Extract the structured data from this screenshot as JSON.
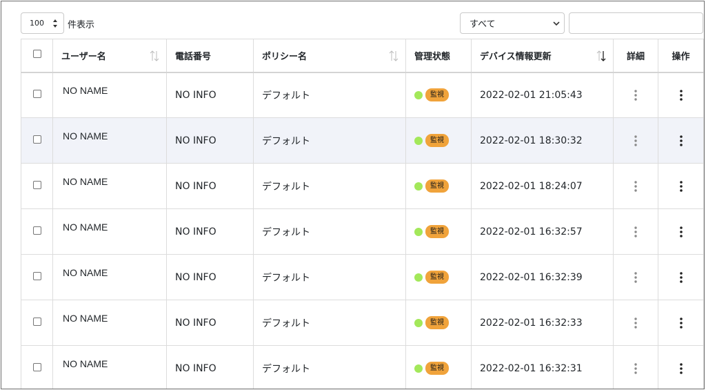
{
  "toolbar": {
    "length_value": "100",
    "length_label": "件表示",
    "filter_value": "すべて",
    "search_value": ""
  },
  "table": {
    "headers": {
      "user": "ユーザー名",
      "phone": "電話番号",
      "policy": "ポリシー名",
      "state": "管理状態",
      "updated": "デバイス情報更新",
      "detail": "詳細",
      "operation": "操作"
    },
    "rows": [
      {
        "user": "NO NAME",
        "phone": "NO INFO",
        "policy": "デフォルト",
        "state": "監視",
        "updated": "2022-02-01 21:05:43"
      },
      {
        "user": "NO NAME",
        "phone": "NO INFO",
        "policy": "デフォルト",
        "state": "監視",
        "updated": "2022-02-01 18:30:32"
      },
      {
        "user": "NO NAME",
        "phone": "NO INFO",
        "policy": "デフォルト",
        "state": "監視",
        "updated": "2022-02-01 18:24:07"
      },
      {
        "user": "NO NAME",
        "phone": "NO INFO",
        "policy": "デフォルト",
        "state": "監視",
        "updated": "2022-02-01 16:32:57"
      },
      {
        "user": "NO NAME",
        "phone": "NO INFO",
        "policy": "デフォルト",
        "state": "監視",
        "updated": "2022-02-01 16:32:39"
      },
      {
        "user": "NO NAME",
        "phone": "NO INFO",
        "policy": "デフォルト",
        "state": "監視",
        "updated": "2022-02-01 16:32:33"
      },
      {
        "user": "NO NAME",
        "phone": "NO INFO",
        "policy": "デフォルト",
        "state": "監視",
        "updated": "2022-02-01 16:32:31"
      }
    ]
  },
  "icons": {
    "sort": "sort-icon",
    "detail": "kebab-icon",
    "operation": "kebab-icon"
  },
  "colors": {
    "status_dot": "#a3e85a",
    "badge": "#f0a33b",
    "row_highlight": "#f1f3f9"
  }
}
